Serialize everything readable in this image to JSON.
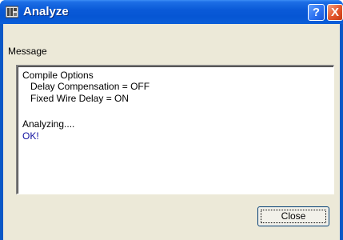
{
  "window": {
    "title": "Analyze",
    "help_glyph": "?",
    "close_glyph": "X"
  },
  "message": {
    "label": "Message",
    "lines": [
      "Compile Options",
      "   Delay Compensation = OFF",
      "   Fixed Wire Delay = ON",
      "",
      "Analyzing....",
      "OK!"
    ]
  },
  "buttons": {
    "close_label": "Close"
  },
  "colors": {
    "titlebar": "#0a58c6",
    "ok_text": "#1010a0",
    "dialog_bg": "#ece9d8"
  },
  "icons": {
    "app": "analyze-app-icon",
    "help": "help-icon",
    "close": "close-icon"
  }
}
